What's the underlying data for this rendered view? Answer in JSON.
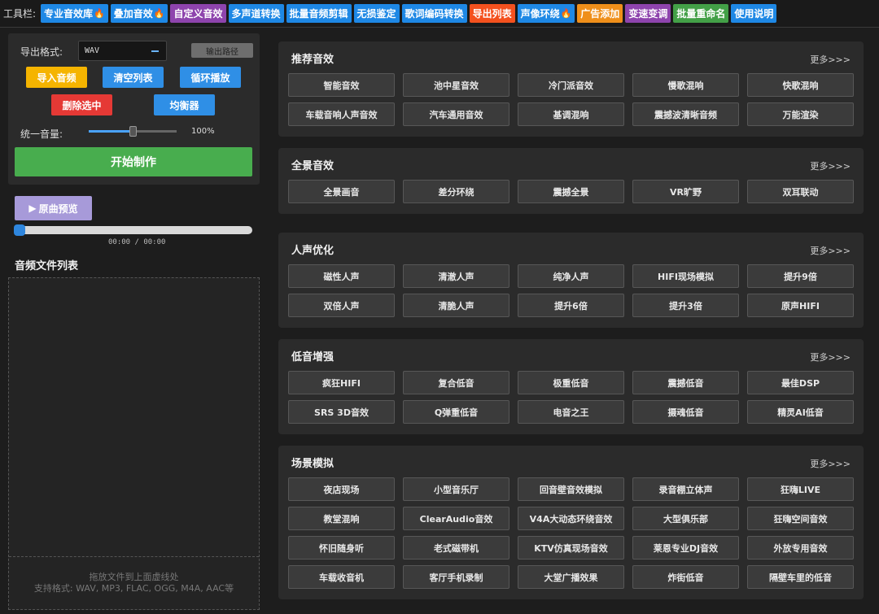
{
  "toolbar": {
    "label": "工具栏:",
    "buttons": [
      {
        "label": "专业音效库",
        "fire": "🔥",
        "color": "#1e88e5"
      },
      {
        "label": "叠加音效",
        "fire": "🔥",
        "color": "#1e88e5"
      },
      {
        "label": "自定义音效",
        "fire": "",
        "color": "#8e44ad"
      },
      {
        "label": "多声道转换",
        "fire": "",
        "color": "#1e88e5"
      },
      {
        "label": "批量音频剪辑",
        "fire": "",
        "color": "#1e88e5"
      },
      {
        "label": "无损鉴定",
        "fire": "",
        "color": "#1e88e5"
      },
      {
        "label": "歌词编码转换",
        "fire": "",
        "color": "#1e88e5"
      },
      {
        "label": "导出列表",
        "fire": "",
        "color": "#f4511e"
      },
      {
        "label": "声像环绕",
        "fire": "🔥",
        "color": "#1e88e5"
      },
      {
        "label": "广告添加",
        "fire": "",
        "color": "#ef8f1a"
      },
      {
        "label": "变速变调",
        "fire": "",
        "color": "#8e44ad"
      },
      {
        "label": "批量重命名",
        "fire": "",
        "color": "#43a047"
      },
      {
        "label": "使用说明",
        "fire": "",
        "color": "#1e88e5"
      }
    ]
  },
  "left": {
    "format_label": "导出格式:",
    "format_value": "WAV",
    "output_path": "输出路径",
    "import_btn": "导入音频",
    "clear_btn": "清空列表",
    "loop_btn": "循环播放",
    "delete_btn": "删除选中",
    "eq_btn": "均衡器",
    "volume_label": "统一音量:",
    "volume_value": "100%",
    "volume_fraction": 0.5,
    "start_btn": "开始制作",
    "preview_btn": "原曲预览",
    "time": "00:00 / 00:00",
    "list_title": "音频文件列表",
    "drop_hint_1": "拖放文件到上面虚线处",
    "drop_hint_2": "支持格式: WAV, MP3, FLAC, OGG, M4A, AAC等"
  },
  "more_label": "更多>>>",
  "sections": [
    {
      "title": "推荐音效",
      "items": [
        "智能音效",
        "池中星音效",
        "冷门派音效",
        "慢歌混响",
        "快歌混响",
        "车载音响人声音效",
        "汽车通用音效",
        "基调混响",
        "震撼波清晰音频",
        "万能渲染"
      ]
    },
    {
      "title": "全景音效",
      "items": [
        "全景画音",
        "差分环绕",
        "震撼全景",
        "VR旷野",
        "双耳联动"
      ]
    },
    {
      "title": "人声优化",
      "items": [
        "磁性人声",
        "清澈人声",
        "纯净人声",
        "HIFI现场模拟",
        "提升9倍",
        "双倍人声",
        "清脆人声",
        "提升6倍",
        "提升3倍",
        "原声HIFI"
      ]
    },
    {
      "title": "低音增强",
      "items": [
        "疯狂HIFI",
        "复合低音",
        "极重低音",
        "震撼低音",
        "最佳DSP",
        "SRS 3D音效",
        "Q弹重低音",
        "电音之王",
        "摄魂低音",
        "精灵AI低音"
      ]
    },
    {
      "title": "场景模拟",
      "items": [
        "夜店现场",
        "小型音乐厅",
        "回音壁音效模拟",
        "录音棚立体声",
        "狂嗨LIVE",
        "教堂混响",
        "ClearAudio音效",
        "V4A大动态环绕音效",
        "大型俱乐部",
        "狂嗨空间音效",
        "怀旧随身听",
        "老式磁带机",
        "KTV仿真现场音效",
        "莱恩专业DJ音效",
        "外放专用音效",
        "车载收音机",
        "客厅手机录制",
        "大堂广播效果",
        "炸街低音",
        "隔壁车里的低音"
      ]
    }
  ]
}
